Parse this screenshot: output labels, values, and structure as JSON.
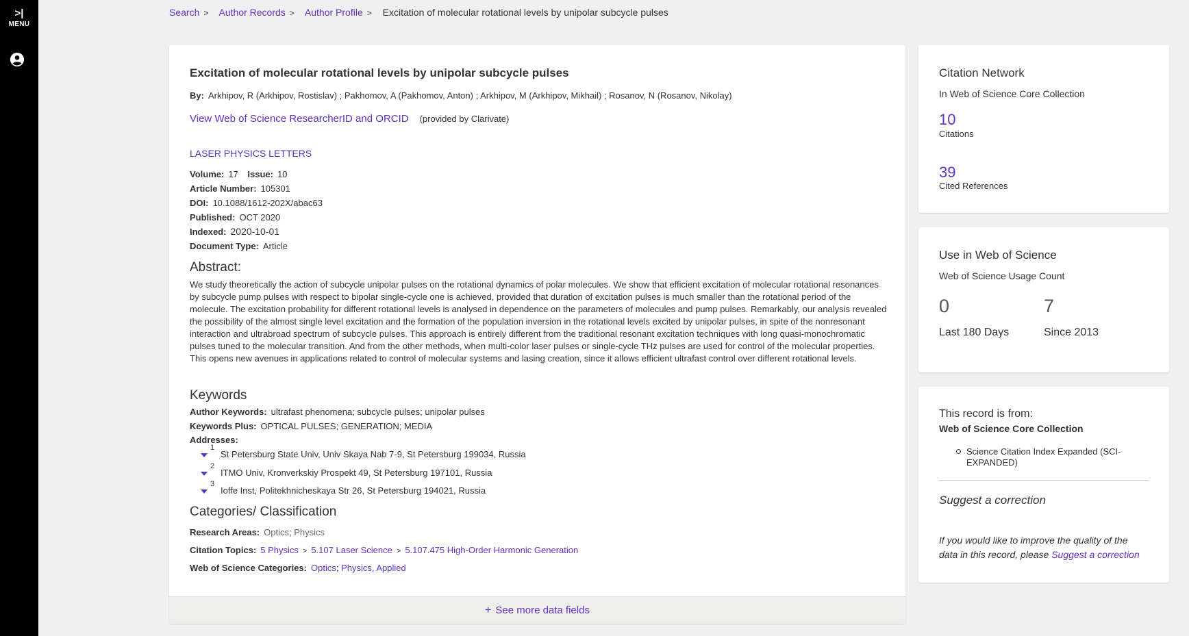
{
  "nav": {
    "menu_label": "MENU",
    "menu_icon": "chevron-right-icon",
    "account_icon": "account-icon"
  },
  "breadcrumbs": [
    "Search",
    "Author Records",
    "Author Profile",
    "Excitation of molecular rotational levels by unipolar subcycle pulses"
  ],
  "record": {
    "title": "Excitation of molecular rotational levels by unipolar subcycle pulses",
    "by_label": "By:",
    "authors": "Arkhipov, R (Arkhipov, Rostislav) ; Pakhomov, A (Pakhomov, Anton) ; Arkhipov, M (Arkhipov, Mikhail) ; Rosanov, N (Rosanov, Nikolay)",
    "orcid_link": "View Web of Science ResearcherID and ORCID",
    "provided_by": "(provided by Clarivate)",
    "journal": "LASER PHYSICS LETTERS",
    "volume_label": "Volume:",
    "volume": "17",
    "issue_label": "Issue:",
    "issue": "10",
    "article_number_label": "Article Number:",
    "article_number": "105301",
    "doi_label": "DOI:",
    "doi": "10.1088/1612-202X/abac63",
    "published_label": "Published:",
    "published": "OCT 2020",
    "indexed_label": "Indexed:",
    "indexed": "2020-10-01",
    "doc_type_label": "Document Type:",
    "doc_type": "Article",
    "abstract_heading": "Abstract:",
    "abstract": "We study theoretically the action of subcycle unipolar pulses on the rotational dynamics of polar molecules. We show that efficient excitation of molecular rotational resonances by subcycle pump pulses with respect to bipolar single-cycle one is achieved, provided that duration of excitation pulses is much smaller than the rotational period of the molecule. The excitation probability for different rotational levels is analysed in dependence on the parameters of molecules and pump pulses. Remarkably, our analysis revealed the possibility of the almost single level excitation and the formation of the population inversion in the rotational levels excited by unipolar pulses, in spite of the nonresonant interaction and ultrabroad spectrum of subcycle pulses. This approach is entirely different from the traditional resonant excitation techniques with long quasi-monochromatic pulses tuned to the molecular transition. And from the other methods, when multi-color laser pulses or single-cycle THz pulses are used for control of the molecular properties. This opens new avenues in applications related to control of molecular systems and lasing creation, since it allows efficient ultrafast control over different rotational levels.",
    "keywords_heading": "Keywords",
    "author_keywords_label": "Author Keywords:",
    "author_keywords": "ultrafast phenomena; subcycle pulses; unipolar pulses",
    "keywords_plus_label": "Keywords Plus:",
    "keywords_plus": "OPTICAL PULSES; GENERATION; MEDIA",
    "addresses_label": "Addresses:",
    "addresses": [
      {
        "num": "1",
        "text": "St Petersburg State Univ, Univ Skaya Nab 7-9, St Petersburg 199034, Russia"
      },
      {
        "num": "2",
        "text": "ITMO Univ, Kronverkskiy Prospekt 49, St Petersburg 197101, Russia"
      },
      {
        "num": "3",
        "text": "Ioffe Inst, Politekhnicheskaya Str 26, St Petersburg 194021, Russia"
      }
    ],
    "categories_heading": "Categories/ Classification",
    "research_areas_label": "Research Areas:",
    "research_areas": [
      "Optics",
      "Physics"
    ],
    "citation_topics_label": "Citation Topics:",
    "citation_topics": [
      "5 Physics",
      "5.107 Laser Science",
      "5.107.475 High-Order Harmonic Generation"
    ],
    "wos_categories_label": "Web of Science Categories:",
    "wos_categories": [
      "Optics",
      "Physics, Applied"
    ],
    "see_more": "See more data fields"
  },
  "citation_network": {
    "heading": "Citation Network",
    "sub": "In Web of Science Core Collection",
    "citations": "10",
    "citations_label": "Citations",
    "cited_refs": "39",
    "cited_refs_label": "Cited References"
  },
  "usage": {
    "heading": "Use in Web of Science",
    "sub": "Web of Science Usage Count",
    "last180": "0",
    "last180_label": "Last 180 Days",
    "since2013": "7",
    "since2013_label": "Since 2013"
  },
  "source": {
    "heading": "This record is from:",
    "collection": "Web of Science Core Collection",
    "index": "Science Citation Index Expanded (SCI-EXPANDED)",
    "suggest_heading": "Suggest a correction",
    "suggest_text": "If you would like to improve the quality of the data in this record, please",
    "suggest_link": "Suggest a correction"
  },
  "colors": {
    "accent": "#5e33bf",
    "rail": "#000000",
    "background": "#f0f0f0"
  }
}
